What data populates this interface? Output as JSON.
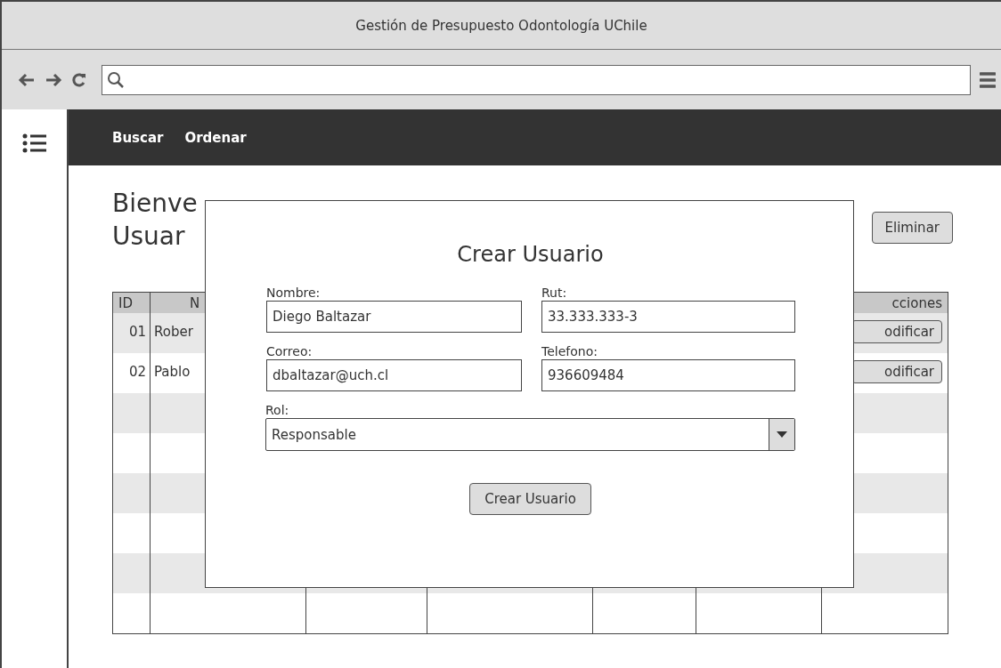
{
  "window": {
    "title": "Gestión de Presupuesto Odontología UChile"
  },
  "nav": {
    "items": [
      "Buscar",
      "Ordenar"
    ]
  },
  "page": {
    "heading_lines": [
      "Bienve",
      "Usuar"
    ],
    "delete_button": "Eliminar"
  },
  "table": {
    "column_1": "ID",
    "column_2": "N",
    "column_7": "cciones",
    "rows": [
      {
        "id": "01",
        "column_2": "Rober",
        "action_button": "odificar"
      },
      {
        "id": "02",
        "column_2": "Pablo",
        "action_button": "odificar"
      }
    ]
  },
  "dialog": {
    "title": "Crear Usuario",
    "fields": [
      {
        "label": "Nombre:",
        "value": "Diego Baltazar"
      },
      {
        "label": "Rut:",
        "value": "33.333.333-3"
      },
      {
        "label": "Correo:",
        "value": "dbaltazar@uch.cl"
      },
      {
        "label": "Telefono:",
        "value": "936609484"
      }
    ],
    "role": {
      "label": "Rol:",
      "value": "Responsable"
    },
    "submit": "Crear Usuario"
  }
}
